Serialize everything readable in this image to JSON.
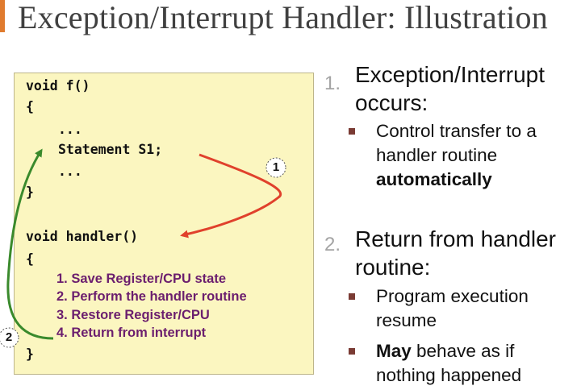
{
  "title": "Exception/Interrupt Handler: Illustration",
  "code": {
    "f_decl": "void f()",
    "open1": "{",
    "dots1": "...",
    "stmt": "Statement S1;",
    "dots2": "...",
    "close1": "}",
    "handler_decl": "void handler()",
    "open2": "{",
    "steps": [
      "1. Save Register/CPU state",
      "2. Perform the handler routine",
      "3. Restore Register/CPU",
      "4. Return from interrupt"
    ],
    "close2": "}"
  },
  "markers": {
    "one": "1",
    "two": "2"
  },
  "points": [
    {
      "number": "1.",
      "heading_line1": "Exception/Interrupt",
      "heading_line2": "occurs:",
      "subs": [
        {
          "line1": "Control transfer to a",
          "line2": "handler routine",
          "line3_bold": "automatically"
        }
      ]
    },
    {
      "number": "2.",
      "heading_line1": "Return from handler",
      "heading_line2": "routine:",
      "subs": [
        {
          "line1": "Program execution",
          "line2": "resume"
        },
        {
          "bold_prefix": "May",
          "line1_rest": " behave as if",
          "line2": "nothing happened"
        }
      ]
    }
  ],
  "colors": {
    "arrow1": "#e0412c",
    "arrow2": "#3a8a2c",
    "steps": "#6b1e6e",
    "box": "#fbf6c0",
    "accent": "#e07b2e"
  }
}
